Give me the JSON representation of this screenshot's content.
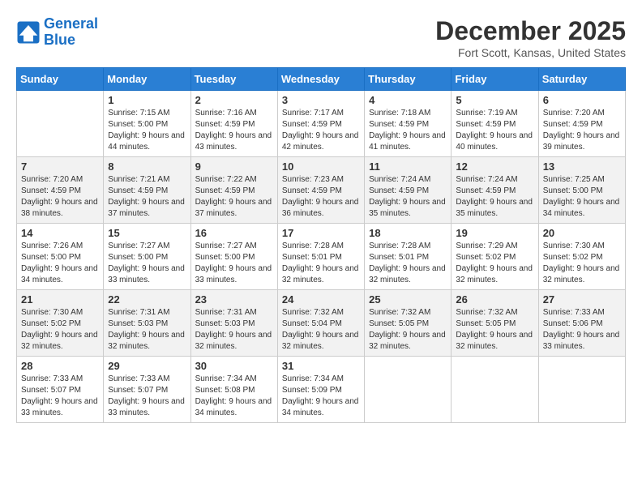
{
  "header": {
    "logo_line1": "General",
    "logo_line2": "Blue",
    "month_title": "December 2025",
    "location": "Fort Scott, Kansas, United States"
  },
  "weekdays": [
    "Sunday",
    "Monday",
    "Tuesday",
    "Wednesday",
    "Thursday",
    "Friday",
    "Saturday"
  ],
  "weeks": [
    [
      {
        "day": "",
        "sunrise": "",
        "sunset": "",
        "daylight": ""
      },
      {
        "day": "1",
        "sunrise": "Sunrise: 7:15 AM",
        "sunset": "Sunset: 5:00 PM",
        "daylight": "Daylight: 9 hours and 44 minutes."
      },
      {
        "day": "2",
        "sunrise": "Sunrise: 7:16 AM",
        "sunset": "Sunset: 4:59 PM",
        "daylight": "Daylight: 9 hours and 43 minutes."
      },
      {
        "day": "3",
        "sunrise": "Sunrise: 7:17 AM",
        "sunset": "Sunset: 4:59 PM",
        "daylight": "Daylight: 9 hours and 42 minutes."
      },
      {
        "day": "4",
        "sunrise": "Sunrise: 7:18 AM",
        "sunset": "Sunset: 4:59 PM",
        "daylight": "Daylight: 9 hours and 41 minutes."
      },
      {
        "day": "5",
        "sunrise": "Sunrise: 7:19 AM",
        "sunset": "Sunset: 4:59 PM",
        "daylight": "Daylight: 9 hours and 40 minutes."
      },
      {
        "day": "6",
        "sunrise": "Sunrise: 7:20 AM",
        "sunset": "Sunset: 4:59 PM",
        "daylight": "Daylight: 9 hours and 39 minutes."
      }
    ],
    [
      {
        "day": "7",
        "sunrise": "Sunrise: 7:20 AM",
        "sunset": "Sunset: 4:59 PM",
        "daylight": "Daylight: 9 hours and 38 minutes."
      },
      {
        "day": "8",
        "sunrise": "Sunrise: 7:21 AM",
        "sunset": "Sunset: 4:59 PM",
        "daylight": "Daylight: 9 hours and 37 minutes."
      },
      {
        "day": "9",
        "sunrise": "Sunrise: 7:22 AM",
        "sunset": "Sunset: 4:59 PM",
        "daylight": "Daylight: 9 hours and 37 minutes."
      },
      {
        "day": "10",
        "sunrise": "Sunrise: 7:23 AM",
        "sunset": "Sunset: 4:59 PM",
        "daylight": "Daylight: 9 hours and 36 minutes."
      },
      {
        "day": "11",
        "sunrise": "Sunrise: 7:24 AM",
        "sunset": "Sunset: 4:59 PM",
        "daylight": "Daylight: 9 hours and 35 minutes."
      },
      {
        "day": "12",
        "sunrise": "Sunrise: 7:24 AM",
        "sunset": "Sunset: 4:59 PM",
        "daylight": "Daylight: 9 hours and 35 minutes."
      },
      {
        "day": "13",
        "sunrise": "Sunrise: 7:25 AM",
        "sunset": "Sunset: 5:00 PM",
        "daylight": "Daylight: 9 hours and 34 minutes."
      }
    ],
    [
      {
        "day": "14",
        "sunrise": "Sunrise: 7:26 AM",
        "sunset": "Sunset: 5:00 PM",
        "daylight": "Daylight: 9 hours and 34 minutes."
      },
      {
        "day": "15",
        "sunrise": "Sunrise: 7:27 AM",
        "sunset": "Sunset: 5:00 PM",
        "daylight": "Daylight: 9 hours and 33 minutes."
      },
      {
        "day": "16",
        "sunrise": "Sunrise: 7:27 AM",
        "sunset": "Sunset: 5:00 PM",
        "daylight": "Daylight: 9 hours and 33 minutes."
      },
      {
        "day": "17",
        "sunrise": "Sunrise: 7:28 AM",
        "sunset": "Sunset: 5:01 PM",
        "daylight": "Daylight: 9 hours and 32 minutes."
      },
      {
        "day": "18",
        "sunrise": "Sunrise: 7:28 AM",
        "sunset": "Sunset: 5:01 PM",
        "daylight": "Daylight: 9 hours and 32 minutes."
      },
      {
        "day": "19",
        "sunrise": "Sunrise: 7:29 AM",
        "sunset": "Sunset: 5:02 PM",
        "daylight": "Daylight: 9 hours and 32 minutes."
      },
      {
        "day": "20",
        "sunrise": "Sunrise: 7:30 AM",
        "sunset": "Sunset: 5:02 PM",
        "daylight": "Daylight: 9 hours and 32 minutes."
      }
    ],
    [
      {
        "day": "21",
        "sunrise": "Sunrise: 7:30 AM",
        "sunset": "Sunset: 5:02 PM",
        "daylight": "Daylight: 9 hours and 32 minutes."
      },
      {
        "day": "22",
        "sunrise": "Sunrise: 7:31 AM",
        "sunset": "Sunset: 5:03 PM",
        "daylight": "Daylight: 9 hours and 32 minutes."
      },
      {
        "day": "23",
        "sunrise": "Sunrise: 7:31 AM",
        "sunset": "Sunset: 5:03 PM",
        "daylight": "Daylight: 9 hours and 32 minutes."
      },
      {
        "day": "24",
        "sunrise": "Sunrise: 7:32 AM",
        "sunset": "Sunset: 5:04 PM",
        "daylight": "Daylight: 9 hours and 32 minutes."
      },
      {
        "day": "25",
        "sunrise": "Sunrise: 7:32 AM",
        "sunset": "Sunset: 5:05 PM",
        "daylight": "Daylight: 9 hours and 32 minutes."
      },
      {
        "day": "26",
        "sunrise": "Sunrise: 7:32 AM",
        "sunset": "Sunset: 5:05 PM",
        "daylight": "Daylight: 9 hours and 32 minutes."
      },
      {
        "day": "27",
        "sunrise": "Sunrise: 7:33 AM",
        "sunset": "Sunset: 5:06 PM",
        "daylight": "Daylight: 9 hours and 33 minutes."
      }
    ],
    [
      {
        "day": "28",
        "sunrise": "Sunrise: 7:33 AM",
        "sunset": "Sunset: 5:07 PM",
        "daylight": "Daylight: 9 hours and 33 minutes."
      },
      {
        "day": "29",
        "sunrise": "Sunrise: 7:33 AM",
        "sunset": "Sunset: 5:07 PM",
        "daylight": "Daylight: 9 hours and 33 minutes."
      },
      {
        "day": "30",
        "sunrise": "Sunrise: 7:34 AM",
        "sunset": "Sunset: 5:08 PM",
        "daylight": "Daylight: 9 hours and 34 minutes."
      },
      {
        "day": "31",
        "sunrise": "Sunrise: 7:34 AM",
        "sunset": "Sunset: 5:09 PM",
        "daylight": "Daylight: 9 hours and 34 minutes."
      },
      {
        "day": "",
        "sunrise": "",
        "sunset": "",
        "daylight": ""
      },
      {
        "day": "",
        "sunrise": "",
        "sunset": "",
        "daylight": ""
      },
      {
        "day": "",
        "sunrise": "",
        "sunset": "",
        "daylight": ""
      }
    ]
  ]
}
